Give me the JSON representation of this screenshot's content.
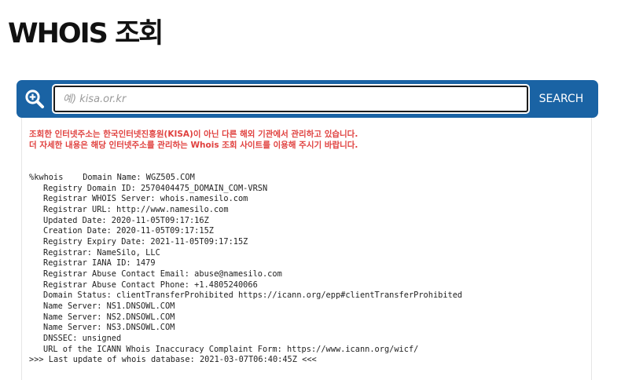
{
  "page": {
    "title": "WHOIS 조회"
  },
  "search": {
    "placeholder": "예) kisa.or.kr",
    "value": "",
    "button_label": "SEARCH"
  },
  "notice": {
    "line1": "조회한 인터넷주소는 한국인터넷진흥원(KISA)이 아닌 다른 해외 기관에서 관리하고 있습니다.",
    "line2": "더 자세한 내용은 해당 인터넷주소를 관리하는 Whois 조회 사이트를 이용해 주시기 바랍니다."
  },
  "whois": {
    "first_line": "%kwhois    Domain Name: WGZ505.COM",
    "lines": [
      "Registry Domain ID: 2570404475_DOMAIN_COM-VRSN",
      "Registrar WHOIS Server: whois.namesilo.com",
      "Registrar URL: http://www.namesilo.com",
      "Updated Date: 2020-11-05T09:17:16Z",
      "Creation Date: 2020-11-05T09:17:15Z",
      "Registry Expiry Date: 2021-11-05T09:17:15Z",
      "Registrar: NameSilo, LLC",
      "Registrar IANA ID: 1479",
      "Registrar Abuse Contact Email: abuse@namesilo.com",
      "Registrar Abuse Contact Phone: +1.4805240066",
      "Domain Status: clientTransferProhibited https://icann.org/epp#clientTransferProhibited",
      "Name Server: NS1.DNSOWL.COM",
      "Name Server: NS2.DNSOWL.COM",
      "Name Server: NS3.DNSOWL.COM",
      "DNSSEC: unsigned",
      "URL of the ICANN Whois Inaccuracy Complaint Form: https://www.icann.org/wicf/"
    ],
    "last_line": ">>> Last update of whois database: 2021-03-07T06:40:45Z <<<"
  },
  "colors": {
    "accent": "#1a63a4",
    "notice": "#e0413f"
  },
  "icons": {
    "search": "search-magnifier-plus-icon"
  }
}
